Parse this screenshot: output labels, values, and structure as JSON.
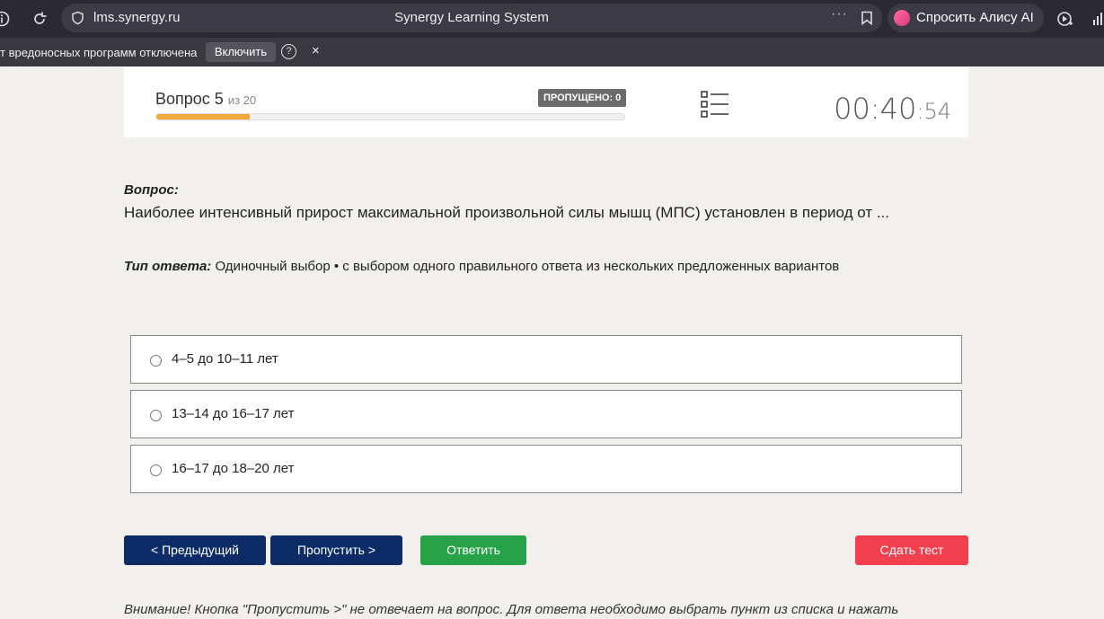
{
  "browser": {
    "host": "lms.synergy.ru",
    "title": "Synergy Learning System",
    "more": "···",
    "alice_label": "Спросить Алису AI"
  },
  "warning": {
    "text": "т вредоносных программ отключена",
    "enable_label": "Включить",
    "help": "?",
    "close": "×"
  },
  "header": {
    "question_label": "Вопрос 5",
    "of_label": "из 20",
    "skipped_label": "ПРОПУЩЕНО: 0",
    "progress": 0.2,
    "timer_main": "00:40",
    "timer_sep": ":",
    "timer_seconds": "54",
    "accent_color": "#f2a93b"
  },
  "question": {
    "caption": "Вопрос:",
    "text": "Наиболее интенсивный прирост максимальной произвольной силы мышц (МПС) установлен в период от ...",
    "answer_type_label": "Тип ответа:",
    "answer_type_value": "Одиночный выбор • с выбором одного правильного ответа из нескольких предложенных вариантов"
  },
  "options": [
    {
      "label": "4–5 до 10–11 лет"
    },
    {
      "label": "13–14 до 16–17 лет"
    },
    {
      "label": "16–17 до 18–20 лет"
    }
  ],
  "buttons": {
    "prev": "< Предыдущий",
    "skip": "Пропустить >",
    "answer": "Ответить",
    "submit": "Сдать тест"
  },
  "notice": "Внимание! Кнопка \"Пропустить >\" не отвечает на вопрос. Для ответа необходимо выбрать пункт из списка и нажать"
}
